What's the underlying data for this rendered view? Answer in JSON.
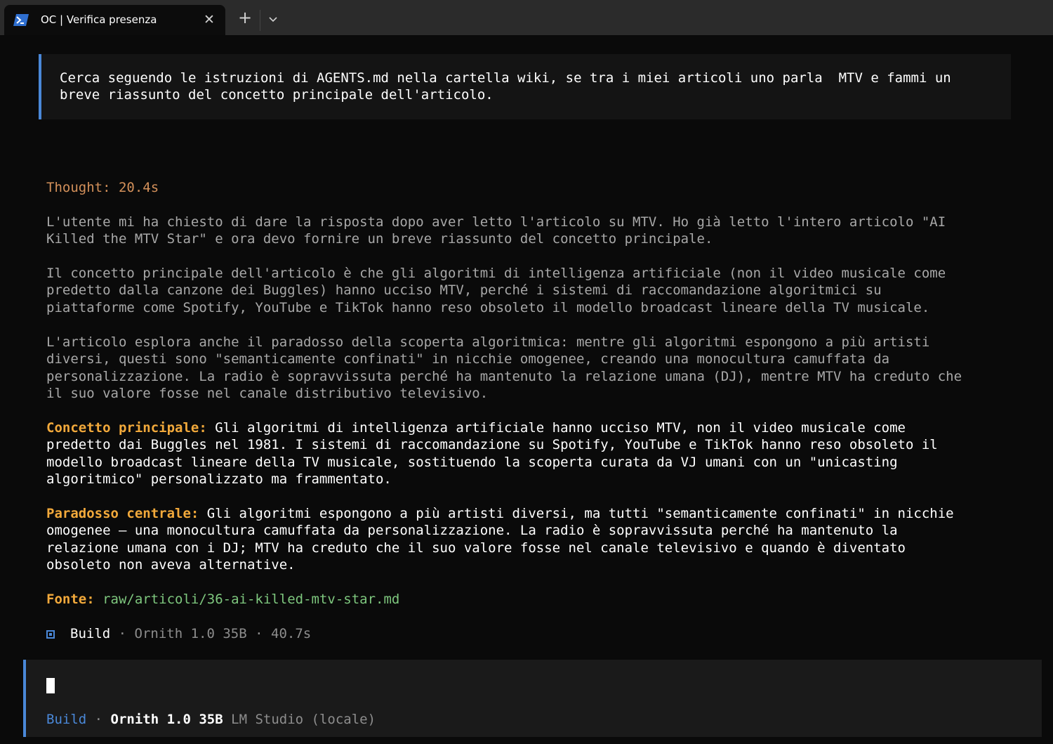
{
  "tab": {
    "title": "OC | Verifica presenza",
    "icon": "powershell-icon",
    "close_label": "✕",
    "new_tab_label": "+",
    "dropdown_icon": "chevron-down-icon"
  },
  "prompt": {
    "text": "Cerca seguendo le istruzioni di AGENTS.md nella cartella wiki, se tra i miei articoli uno parla  MTV e fammi un\nbreve riassunto del concetto principale dell'articolo."
  },
  "thought": {
    "label": "Thought: 20.4s",
    "paragraphs": [
      "L'utente mi ha chiesto di dare la risposta dopo aver letto l'articolo su MTV. Ho già letto l'intero articolo \"AI\nKilled the MTV Star\" e ora devo fornire un breve riassunto del concetto principale.",
      "Il concetto principale dell'articolo è che gli algoritmi di intelligenza artificiale (non il video musicale come\npredetto dalla canzone dei Buggles) hanno ucciso MTV, perché i sistemi di raccomandazione algoritmici su\npiattaforme come Spotify, YouTube e TikTok hanno reso obsoleto il modello broadcast lineare della TV musicale.",
      "L'articolo esplora anche il paradosso della scoperta algoritmica: mentre gli algoritmi espongono a più artisti\ndiversi, questi sono \"semanticamente confinati\" in nicchie omogenee, creando una monocultura camuffata da\npersonalizzazione. La radio è sopravvissuta perché ha mantenuto la relazione umana (DJ), mentre MTV ha creduto che\nil suo valore fosse nel canale distributivo televisivo."
    ]
  },
  "answer": {
    "concept_label": "Concetto principale:",
    "concept_text": " Gli algoritmi di intelligenza artificiale hanno ucciso MTV, non il video musicale come\npredetto dai Buggles nel 1981. I sistemi di raccomandazione su Spotify, YouTube e TikTok hanno reso obsoleto il\nmodello broadcast lineare della TV musicale, sostituendo la scoperta curata da VJ umani con un \"unicasting\nalgoritmico\" personalizzato ma frammentato.",
    "paradox_label": "Paradosso centrale:",
    "paradox_text": " Gli algoritmi espongono a più artisti diversi, ma tutti \"semanticamente confinati\" in nicchie\nomogenee — una monocultura camuffata da personalizzazione. La radio è sopravvissuta perché ha mantenuto la\nrelazione umana con i DJ; MTV ha creduto che il suo valore fosse nel canale televisivo e quando è diventato\nobsoleto non aveva alternative.",
    "source_label": "Fonte:",
    "source_path": "raw/articoli/36-ai-killed-mtv-star.md"
  },
  "build_summary": {
    "icon": "build-square-icon",
    "mode": "Build",
    "separator": " · ",
    "model": "Ornith 1.0 35B",
    "duration": "40.7s"
  },
  "input": {
    "mode": "Build",
    "separator": " · ",
    "model": "Ornith 1.0 35B",
    "provider": "LM Studio (locale)"
  },
  "colors": {
    "accent_blue": "#4a88d8",
    "thought": "#d3905a",
    "highlight": "#f2a93b",
    "path": "#7ec77e"
  }
}
